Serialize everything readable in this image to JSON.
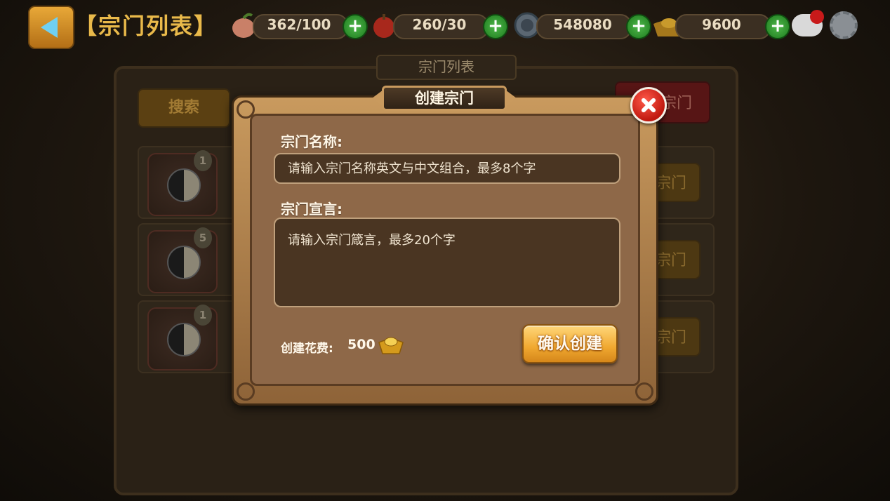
{
  "header": {
    "page_title": "【宗门列表】",
    "resources": [
      {
        "icon": "peach-icon",
        "value": "362/100"
      },
      {
        "icon": "apple-icon",
        "value": "260/30"
      },
      {
        "icon": "silver-coin-icon",
        "value": "548080"
      },
      {
        "icon": "gold-ingot-icon",
        "value": "9600"
      }
    ]
  },
  "panel": {
    "title": "宗门列表",
    "search_label": "搜索",
    "create_label_partial": "宗门",
    "rows": [
      {
        "rank": "1",
        "button_partial": "宗门"
      },
      {
        "rank": "5",
        "button_partial": "宗门"
      },
      {
        "rank": "1",
        "button_partial": "宗门"
      }
    ]
  },
  "dialog": {
    "title": "创建宗门",
    "name_label": "宗门名称:",
    "name_placeholder": "请输入宗门名称英文与中文组合，最多8个字",
    "motto_label": "宗门宣言:",
    "motto_placeholder": "请输入宗门箴言，最多20个字",
    "cost_label": "创建花费:",
    "cost_value": "500",
    "cost_icon": "gold-ingot-icon",
    "confirm_label": "确认创建"
  },
  "colors": {
    "dialog_frame": "#c99a5e",
    "dialog_body": "#8e6848",
    "confirm_button": "#f0a830",
    "close_button": "#c0180f"
  }
}
